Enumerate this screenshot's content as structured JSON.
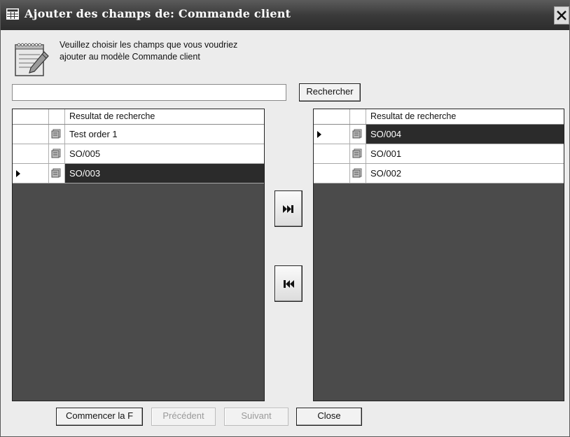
{
  "window": {
    "title": "Ajouter des champs de:  Commande client",
    "title_icon": "grid-window-icon",
    "close_icon": "close-icon"
  },
  "instruction": "Veuillez choisir les champs que vous voudriez\najouter au modèle Commande client",
  "search": {
    "value": "",
    "button_label": "Rechercher"
  },
  "left_grid": {
    "header": "Resultat de recherche",
    "rows": [
      {
        "label": "Test order 1",
        "selected": false,
        "current": false
      },
      {
        "label": "SO/005",
        "selected": false,
        "current": false
      },
      {
        "label": "SO/003",
        "selected": true,
        "current": true
      }
    ]
  },
  "right_grid": {
    "header": "Resultat de recherche",
    "rows": [
      {
        "label": "SO/004",
        "selected": true,
        "current": true
      },
      {
        "label": "SO/001",
        "selected": false,
        "current": false
      },
      {
        "label": "SO/002",
        "selected": false,
        "current": false
      }
    ]
  },
  "move_buttons": {
    "add_icon": "skip-forward-icon",
    "remove_icon": "skip-back-icon"
  },
  "footer": {
    "start": "Commencer  la F",
    "previous": "Précédent",
    "next": "Suivant",
    "close": "Close"
  },
  "colors": {
    "grid_background": "#4b4b4b",
    "selected_row": "#2b2b2b",
    "title_bar": "#3a3a3a"
  }
}
